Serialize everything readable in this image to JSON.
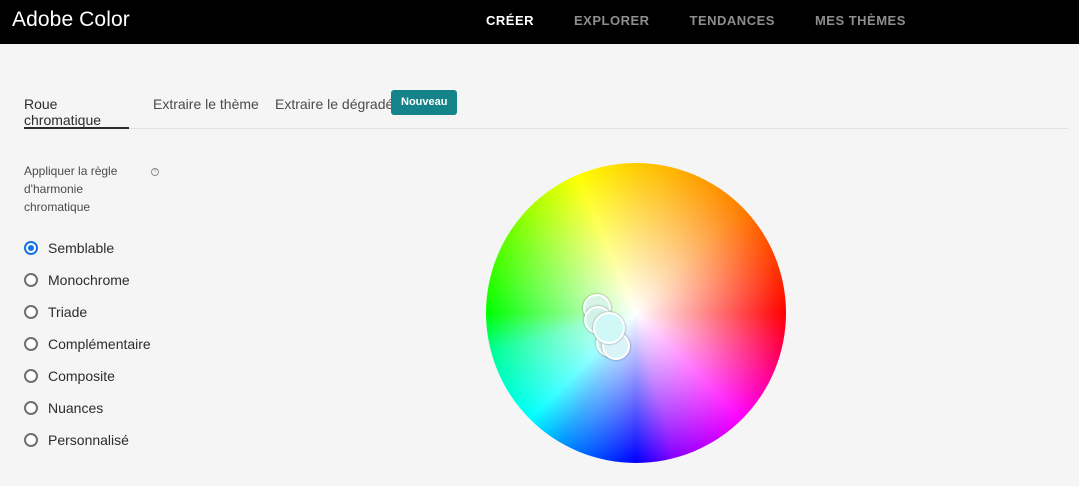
{
  "app": {
    "title": "Adobe Color"
  },
  "topnav": {
    "items": [
      {
        "label": "CRÉER",
        "active": true
      },
      {
        "label": "EXPLORER",
        "active": false
      },
      {
        "label": "TENDANCES",
        "active": false
      },
      {
        "label": "MES THÈMES",
        "active": false
      }
    ]
  },
  "tabs": {
    "items": [
      {
        "label": "Roue chromatique",
        "active": true
      },
      {
        "label": "Extraire le thème",
        "active": false
      },
      {
        "label": "Extraire le dégradé",
        "active": false
      }
    ],
    "badge": "Nouveau"
  },
  "harmony": {
    "label": "Appliquer la règle d'harmonie chromatique",
    "help_icon": "question-circle-icon",
    "options": [
      {
        "label": "Semblable",
        "selected": true
      },
      {
        "label": "Monochrome",
        "selected": false
      },
      {
        "label": "Triade",
        "selected": false
      },
      {
        "label": "Complémentaire",
        "selected": false
      },
      {
        "label": "Composite",
        "selected": false
      },
      {
        "label": "Nuances",
        "selected": false
      },
      {
        "label": "Personnalisé",
        "selected": false
      }
    ]
  },
  "wheel": {
    "handles": [
      {
        "color": "#d6f5e6"
      },
      {
        "color": "#d2f3ea"
      },
      {
        "color": "#cff5f3"
      },
      {
        "color": "#d9f3f7"
      },
      {
        "color": "#cff8f6"
      }
    ]
  },
  "colors": {
    "accent": "#15848a",
    "radio_selected": "#1473e6",
    "topbar": "#000000"
  }
}
